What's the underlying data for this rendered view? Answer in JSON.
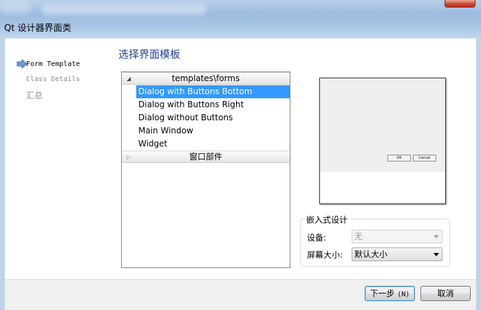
{
  "window": {
    "title": "Qt 设计器界面类"
  },
  "nav": {
    "items": [
      {
        "label": "Form Template",
        "active": true
      },
      {
        "label": "Class Details",
        "active": false
      },
      {
        "label": "汇总",
        "active": false
      }
    ]
  },
  "page": {
    "title": "选择界面模板"
  },
  "tree": {
    "categories": [
      {
        "label": "templates\\forms",
        "expanded": true,
        "items": [
          {
            "label": "Dialog with Buttons Bottom",
            "selected": true
          },
          {
            "label": "Dialog with Buttons Right",
            "selected": false
          },
          {
            "label": "Dialog without Buttons",
            "selected": false
          },
          {
            "label": "Main Window",
            "selected": false
          },
          {
            "label": "Widget",
            "selected": false
          }
        ]
      },
      {
        "label": "窗口部件",
        "expanded": false
      }
    ]
  },
  "preview": {
    "ok_label": "OK",
    "cancel_label": "Cancel"
  },
  "embedded": {
    "group_title": "嵌入式设计",
    "device_label": "设备:",
    "device_value": "无",
    "screen_label": "屏幕大小:",
    "screen_value": "默认大小"
  },
  "buttons": {
    "next_label": "下一步",
    "next_mnemonic": "(N)",
    "cancel_label": "取消"
  },
  "colors": {
    "selection": "#3399ff",
    "title_accent": "#1f3f8f"
  }
}
